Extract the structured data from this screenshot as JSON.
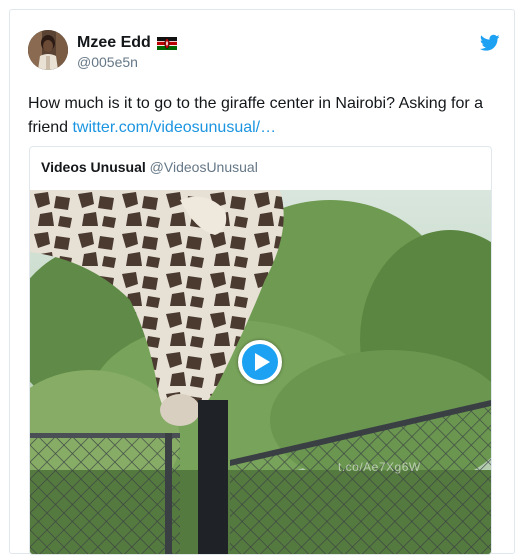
{
  "author": {
    "display_name": "Mzee Edd",
    "handle": "@005e5n",
    "flag_icon": "kenya-flag-icon"
  },
  "tweet": {
    "text": "How much is it to go to the giraffe center in Nairobi? Asking for a friend ",
    "link_text": "twitter.com/videosunusual/…"
  },
  "quoted": {
    "name": "Videos Unusual",
    "handle": "@VideosUnusual",
    "watermark": "t.co/Ae7Xg6W"
  },
  "colors": {
    "link": "#1b95e0",
    "twitter_blue": "#1da1f2",
    "handle_gray": "#657786",
    "border": "#e1e8ed"
  },
  "icons": {
    "logo": "twitter-bird-icon",
    "play": "play-icon"
  }
}
